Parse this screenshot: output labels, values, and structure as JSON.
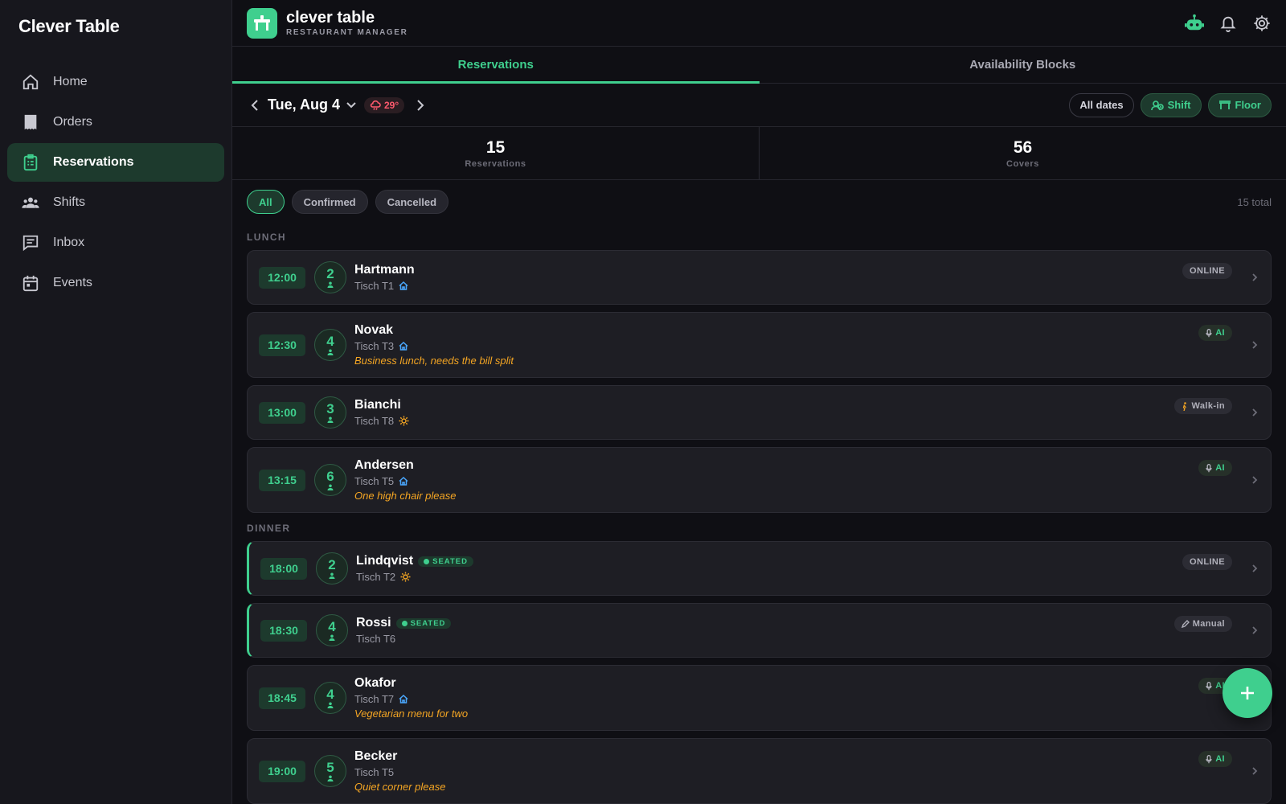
{
  "sidebar": {
    "brand": "Clever Table",
    "items": [
      {
        "label": "Home",
        "icon": "home-icon"
      },
      {
        "label": "Orders",
        "icon": "receipt-icon"
      },
      {
        "label": "Reservations",
        "icon": "clipboard-icon",
        "active": true
      },
      {
        "label": "Shifts",
        "icon": "people-icon"
      },
      {
        "label": "Inbox",
        "icon": "chat-icon"
      },
      {
        "label": "Events",
        "icon": "calendar-icon"
      }
    ]
  },
  "header": {
    "title": "clever table",
    "subtitle": "RESTAURANT MANAGER",
    "icons": [
      "robot-icon",
      "bell-icon",
      "gear-icon"
    ]
  },
  "tabs": [
    {
      "label": "Reservations",
      "active": true
    },
    {
      "label": "Availability Blocks",
      "active": false
    }
  ],
  "datebar": {
    "date": "Tue, Aug 4",
    "weather": "29°",
    "buttons": {
      "all_dates": "All dates",
      "shift": "Shift",
      "floor": "Floor"
    }
  },
  "stats": [
    {
      "value": "15",
      "label": "Reservations"
    },
    {
      "value": "56",
      "label": "Covers"
    }
  ],
  "filters": {
    "chips": [
      "All",
      "Confirmed",
      "Cancelled"
    ],
    "active": "All",
    "total": "15 total"
  },
  "sections": {
    "lunch": "LUNCH",
    "dinner": "DINNER"
  },
  "seated_label": "SEATED",
  "reservations": [
    {
      "time": "12:00",
      "party": "2",
      "name": "Hartmann",
      "table": "Tisch T1",
      "area": "indoor",
      "note": "",
      "source": "ONLINE",
      "source_icon": "",
      "seated": false
    },
    {
      "time": "12:30",
      "party": "4",
      "name": "Novak",
      "table": "Tisch T3",
      "area": "indoor",
      "note": "Business lunch, needs the bill split",
      "source": "AI",
      "source_icon": "mic-icon",
      "seated": false
    },
    {
      "time": "13:00",
      "party": "3",
      "name": "Bianchi",
      "table": "Tisch T8",
      "area": "outdoor",
      "note": "",
      "source": "Walk-in",
      "source_icon": "walk-icon",
      "seated": false
    },
    {
      "time": "13:15",
      "party": "6",
      "name": "Andersen",
      "table": "Tisch T5",
      "area": "indoor",
      "note": "One high chair please",
      "source": "AI",
      "source_icon": "mic-icon",
      "seated": false
    },
    {
      "time": "18:00",
      "party": "2",
      "name": "Lindqvist",
      "table": "Tisch T2",
      "area": "outdoor",
      "note": "",
      "source": "ONLINE",
      "source_icon": "",
      "seated": true
    },
    {
      "time": "18:30",
      "party": "4",
      "name": "Rossi",
      "table": "Tisch T6",
      "area": "",
      "note": "",
      "source": "Manual",
      "source_icon": "pencil-icon",
      "seated": true
    },
    {
      "time": "18:45",
      "party": "4",
      "name": "Okafor",
      "table": "Tisch T7",
      "area": "indoor",
      "note": "Vegetarian menu for two",
      "source": "AI",
      "source_icon": "mic-icon",
      "seated": false
    },
    {
      "time": "19:00",
      "party": "5",
      "name": "Becker",
      "table": "Tisch T5",
      "area": "",
      "note": "Quiet corner please",
      "source": "AI",
      "source_icon": "mic-icon",
      "seated": false
    }
  ],
  "colors": {
    "accent": "#3fcf8e",
    "note": "#f5a623",
    "weather": "#ff5a6e",
    "indoor_icon": "#4aa8ff",
    "outdoor_icon": "#f5a623"
  }
}
